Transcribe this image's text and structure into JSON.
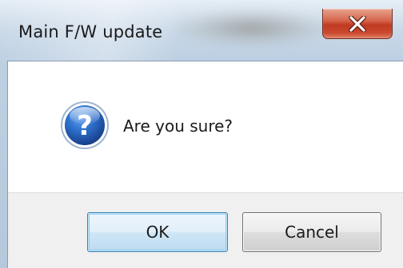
{
  "window": {
    "title": "Main F/W update"
  },
  "dialog": {
    "icon": "question-icon",
    "message": "Are you sure?"
  },
  "buttons": {
    "ok_label": "OK",
    "cancel_label": "Cancel"
  },
  "titlebar_controls": {
    "close_icon": "close-icon"
  },
  "colors": {
    "close_button": "#c03a23",
    "question_icon_blue": "#1e5fb4",
    "button_area_bg": "#f0f0f0"
  }
}
